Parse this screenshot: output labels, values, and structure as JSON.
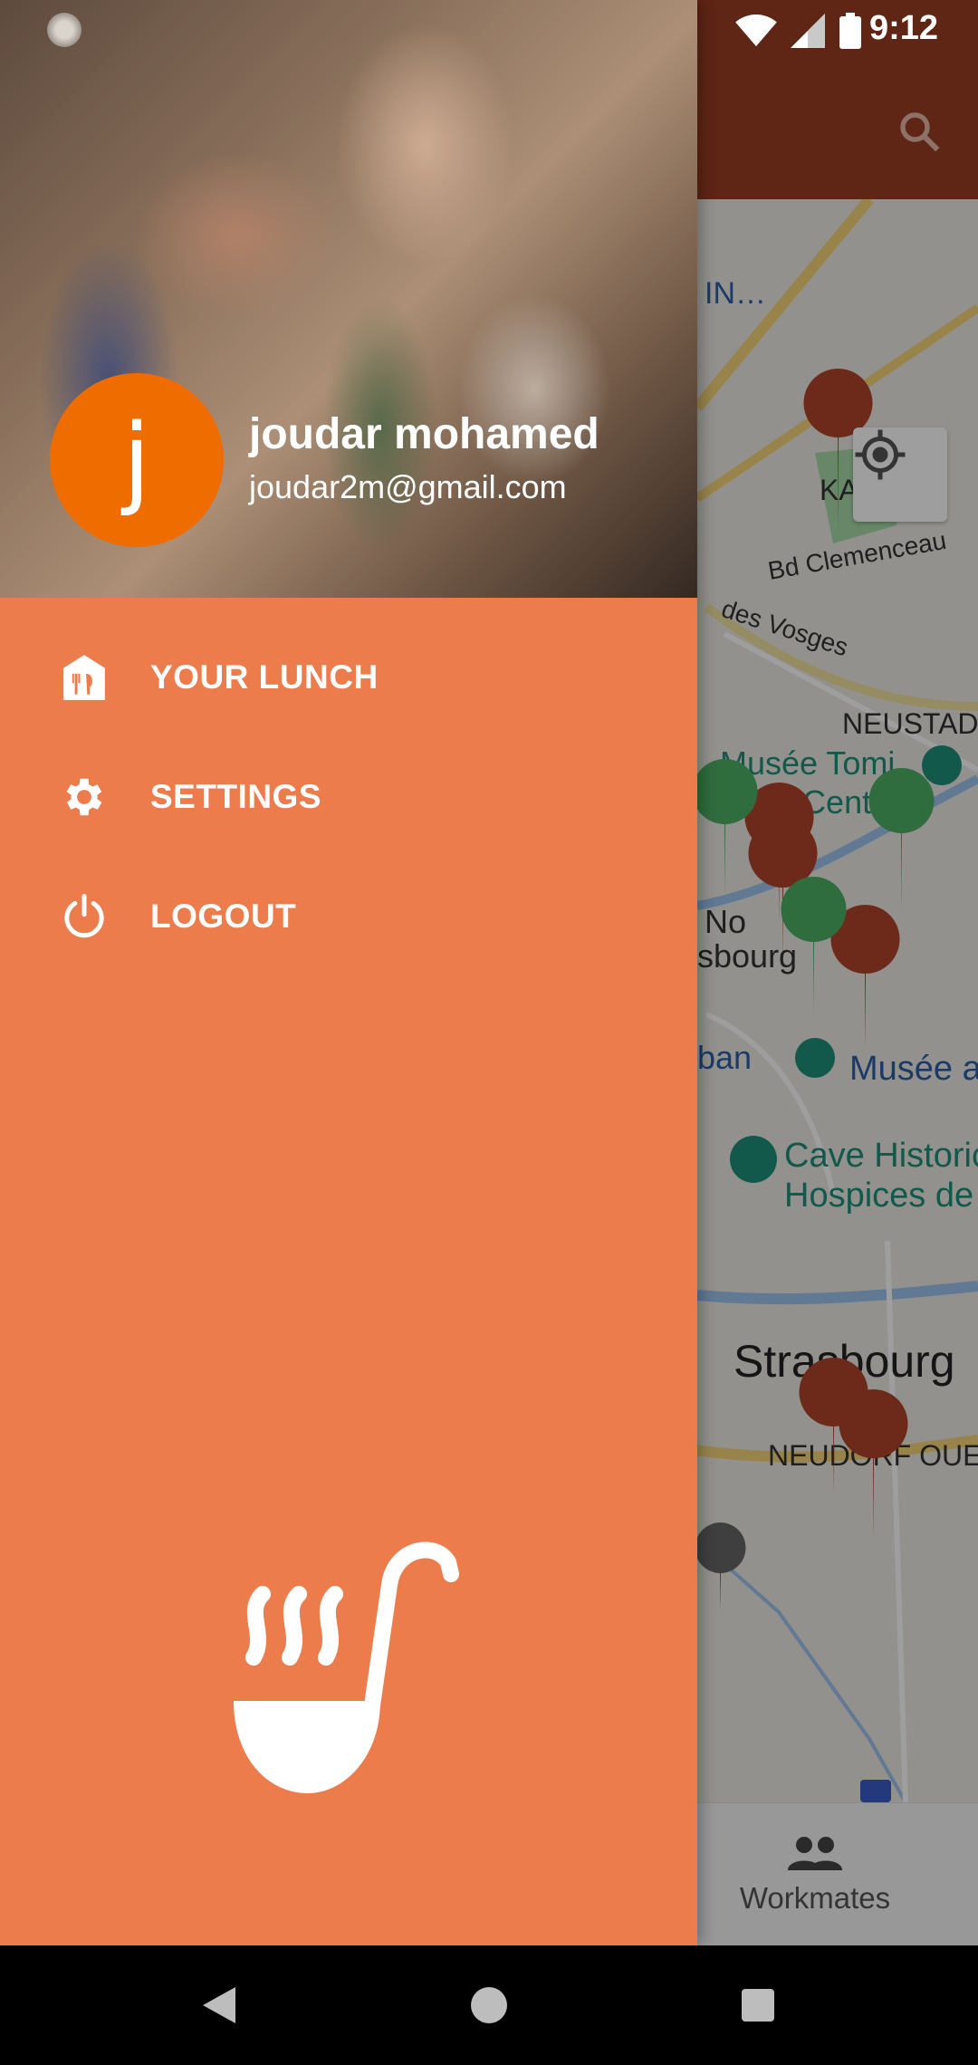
{
  "status_bar": {
    "time": "9:12",
    "icons": [
      "wifi-icon",
      "signal-icon",
      "battery-icon"
    ]
  },
  "drawer": {
    "header": {
      "avatar_letter": "j",
      "user_name": "joudar mohamed",
      "user_email": "joudar2m@gmail.com"
    },
    "items": [
      {
        "label": "YOUR LUNCH",
        "icon": "restaurant-icon"
      },
      {
        "label": "SETTINGS",
        "icon": "gear-icon"
      },
      {
        "label": "LOGOUT",
        "icon": "power-icon"
      }
    ],
    "logo_icon": "soup-ladle-icon"
  },
  "background_app": {
    "map_labels": [
      "IN…",
      "KABLE",
      "Bd Clemenceau",
      "des Vosges",
      "NEUSTAD",
      "Musée Tomi",
      "ngerer-Centre…",
      "No",
      "sbourg",
      "ban",
      "Musée a",
      "Cave Historic",
      "Hospices de",
      "Strasbourg",
      "NEUDORF OUE"
    ],
    "bottom_nav": {
      "workmates_label": "Workmates"
    }
  },
  "colors": {
    "drawer_bg": "#ec7c4c",
    "avatar_bg": "#ef6c00",
    "toolbar": "#9a3d22"
  }
}
